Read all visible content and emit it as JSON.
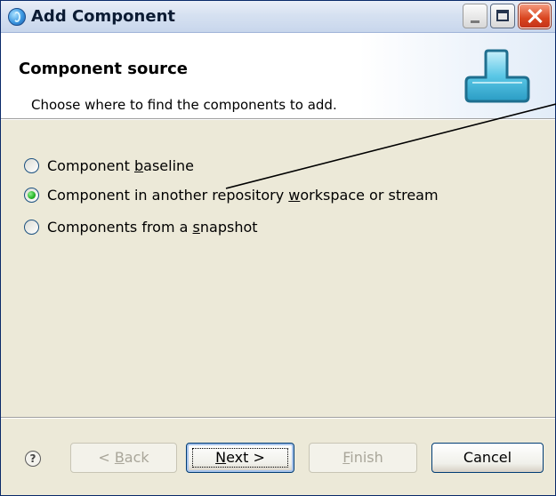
{
  "window": {
    "title": "Add Component"
  },
  "header": {
    "title": "Component source",
    "description": "Choose where to find the components to add."
  },
  "options": [
    {
      "pre": "Component ",
      "mnemonic": "b",
      "post": "aseline",
      "checked": false
    },
    {
      "pre": "Component in another repository ",
      "mnemonic": "w",
      "post": "orkspace or stream",
      "checked": true
    },
    {
      "pre": "Components from a ",
      "mnemonic": "s",
      "post": "napshot",
      "checked": false
    }
  ],
  "buttons": {
    "help": "?",
    "back": {
      "pre": "< ",
      "mnemonic": "B",
      "post": "ack",
      "enabled": false
    },
    "next": {
      "pre": "",
      "mnemonic": "N",
      "post": "ext >",
      "enabled": true
    },
    "finish": {
      "pre": "",
      "mnemonic": "F",
      "post": "inish",
      "enabled": false
    },
    "cancel": "Cancel"
  },
  "icons": {
    "app": "eclipse-globe-icon",
    "banner": "add-component-icon"
  },
  "colors": {
    "accent": "#3a96e0",
    "selected_radio": "#26b326",
    "disabled_text": "#a9a69a"
  }
}
